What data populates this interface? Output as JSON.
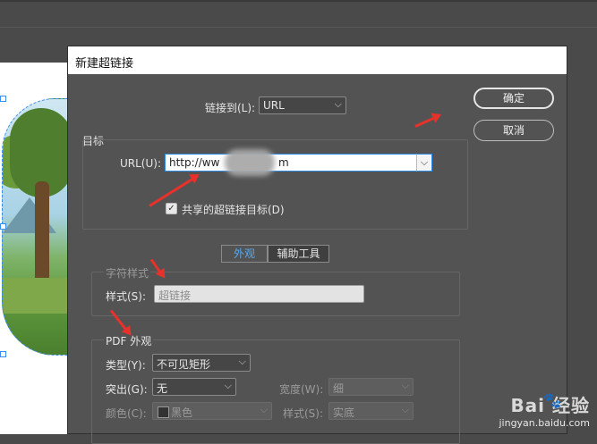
{
  "dialog": {
    "title": "新建超链接",
    "link_to_label": "链接到(L):",
    "link_to_value": "URL",
    "ok_label": "确定",
    "cancel_label": "取消"
  },
  "target": {
    "group_label": "目标",
    "url_label": "URL(U):",
    "url_value_start": "http://ww",
    "url_value_end": "m",
    "shared_checkbox_label": "共享的超链接目标(D)",
    "shared_checked": true
  },
  "tabs": [
    {
      "label": "外观",
      "active": true
    },
    {
      "label": "辅助工具",
      "active": false
    }
  ],
  "char_style": {
    "group_label": "字符样式",
    "style_label": "样式(S):",
    "style_value": "超链接"
  },
  "pdf_appearance": {
    "group_label": "PDF 外观",
    "type_label": "类型(Y):",
    "type_value": "不可见矩形",
    "highlight_label": "突出(G):",
    "highlight_value": "无",
    "width_label": "宽度(W):",
    "width_value": "细",
    "color_label": "颜色(C):",
    "color_value": "黑色",
    "style_label": "样式(S):",
    "style_value": "实底"
  },
  "watermark": {
    "brand": "Bai  经验",
    "url": "jingyan.baidu.com"
  }
}
